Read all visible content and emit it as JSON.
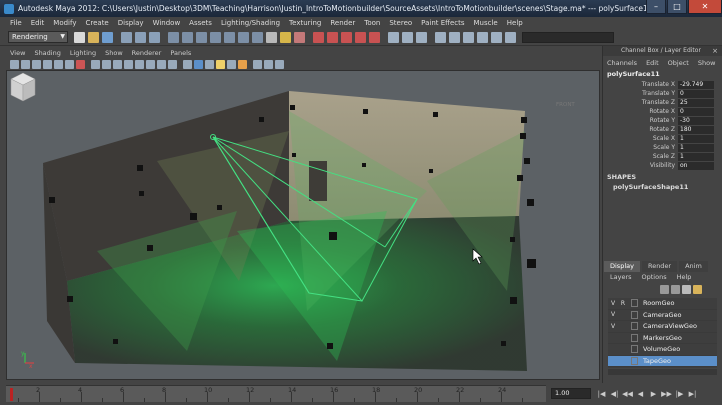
{
  "window": {
    "title": "Autodesk Maya 2012: C:\\Users\\Justin\\Desktop\\3DM\\Teaching\\Harrison\\Justin_IntroToMotionbuilder\\SourceAssets\\IntroToMotionbuilder\\scenes\\Stage.ma*  ---  polySurface11",
    "minimize": "–",
    "maximize": "□",
    "close": "✕"
  },
  "menu": [
    "File",
    "Edit",
    "Modify",
    "Create",
    "Display",
    "Window",
    "Assets",
    "Lighting/Shading",
    "Texturing",
    "Render",
    "Toon",
    "Stereo",
    "Paint Effects",
    "Muscle",
    "Help"
  ],
  "statusline": {
    "mode": "Rendering",
    "arrow": "▼"
  },
  "panel_menu": [
    "View",
    "Shading",
    "Lighting",
    "Show",
    "Renderer",
    "Panels"
  ],
  "viewport": {
    "viewcube_label": "FRONT",
    "axis_y": "y",
    "axis_x": "x",
    "colors": {
      "room": "#3c3a37",
      "wall_light": "#9c9583",
      "light_green": "#3bd06a",
      "frustum": "#3fe07b"
    }
  },
  "channel_box": {
    "header": "Channel Box / Layer Editor",
    "close": "×",
    "tabs": [
      "Channels",
      "Edit",
      "Object",
      "Show"
    ],
    "object_name": "polySurface11",
    "attributes": [
      {
        "name": "Translate X",
        "value": "-29.749"
      },
      {
        "name": "Translate Y",
        "value": "0"
      },
      {
        "name": "Translate Z",
        "value": "25"
      },
      {
        "name": "Rotate X",
        "value": "0"
      },
      {
        "name": "Rotate Y",
        "value": "-30"
      },
      {
        "name": "Rotate Z",
        "value": "180"
      },
      {
        "name": "Scale X",
        "value": "1"
      },
      {
        "name": "Scale Y",
        "value": "1"
      },
      {
        "name": "Scale Z",
        "value": "1"
      },
      {
        "name": "Visibility",
        "value": "on"
      }
    ],
    "shapes_title": "SHAPES",
    "shape_name": "polySurfaceShape11"
  },
  "layer_editor": {
    "tabs": [
      "Display",
      "Render",
      "Anim"
    ],
    "menu": [
      "Layers",
      "Options",
      "Help"
    ],
    "layers": [
      {
        "v": "V",
        "p": "R",
        "name": "RoomGeo",
        "selected": false
      },
      {
        "v": "V",
        "p": "",
        "name": "CameraGeo",
        "selected": false
      },
      {
        "v": "V",
        "p": "",
        "name": "CameraViewGeo",
        "selected": false
      },
      {
        "v": "",
        "p": "",
        "name": "MarkersGeo",
        "selected": false
      },
      {
        "v": "",
        "p": "",
        "name": "VolumeGeo",
        "selected": false
      },
      {
        "v": "",
        "p": "",
        "name": "TapeGeo",
        "selected": true
      }
    ]
  },
  "timeline": {
    "labels": [
      "2",
      "4",
      "6",
      "8",
      "10",
      "12",
      "14",
      "16",
      "18",
      "20",
      "22",
      "24"
    ],
    "current_frame": "1.00"
  },
  "playback": [
    "|◀",
    "◀|",
    "◀◀",
    "◀",
    "▶",
    "▶▶",
    "|▶",
    "▶|"
  ]
}
